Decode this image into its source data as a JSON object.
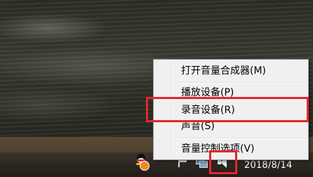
{
  "context_menu": {
    "items": [
      {
        "label": "打开音量合成器(M)"
      },
      {
        "label": "播放设备(P)"
      },
      {
        "label": "录音设备(R)"
      },
      {
        "label": "声音(S)"
      },
      {
        "label": "音量控制选项(V)"
      }
    ]
  },
  "taskbar": {
    "clock": "2018/8/14",
    "tray_icons": [
      "qq-icon",
      "orange-status-icon",
      "flag-icon",
      "network-icon",
      "speaker-icon"
    ]
  },
  "highlight_color": "#e3262b"
}
